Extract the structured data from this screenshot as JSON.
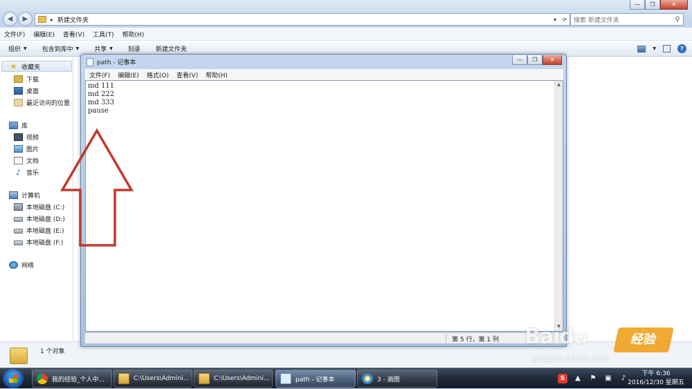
{
  "explorer": {
    "address_path": "新建文件夹",
    "search_placeholder": "搜索 新建文件夹",
    "menu": [
      "文件(F)",
      "编辑(E)",
      "查看(V)",
      "工具(T)",
      "帮助(H)"
    ],
    "commands": [
      "组织",
      "包含到库中",
      "共享",
      "刻录",
      "新建文件夹"
    ],
    "sidebar": {
      "favorites": "收藏夹",
      "favorite_items": [
        "下载",
        "桌面",
        "最近访问的位置"
      ],
      "libraries": "库",
      "library_items": [
        "视频",
        "图片",
        "文档",
        "音乐"
      ],
      "computer": "计算机",
      "drives": [
        "本地磁盘 (C:)",
        "本地磁盘 (D:)",
        "本地磁盘 (E:)",
        "本地磁盘 (F:)"
      ],
      "network": "网络"
    },
    "details": {
      "count": "1 个对象"
    }
  },
  "notepad": {
    "title": "path - 记事本",
    "menu": [
      "文件(F)",
      "编辑(E)",
      "格式(O)",
      "查看(V)",
      "帮助(H)"
    ],
    "content": "md 111\nmd 222\nmd 333\npause",
    "status": "第 5 行，第 1 列"
  },
  "taskbar": {
    "items": [
      "我的经验_个人中...",
      "C:\\Users\\Admini...",
      "C:\\Users\\Admini...",
      "path - 记事本",
      "3 - 画图"
    ],
    "time": "下午 6:36",
    "date": "2016/12/30 星期五"
  },
  "watermark": {
    "logo": "Baidu",
    "sub": "jingyan.baidu.com",
    "badge": "经验"
  },
  "colors": {
    "arrow": "#c0392b",
    "accent": "#3a6ea5"
  }
}
